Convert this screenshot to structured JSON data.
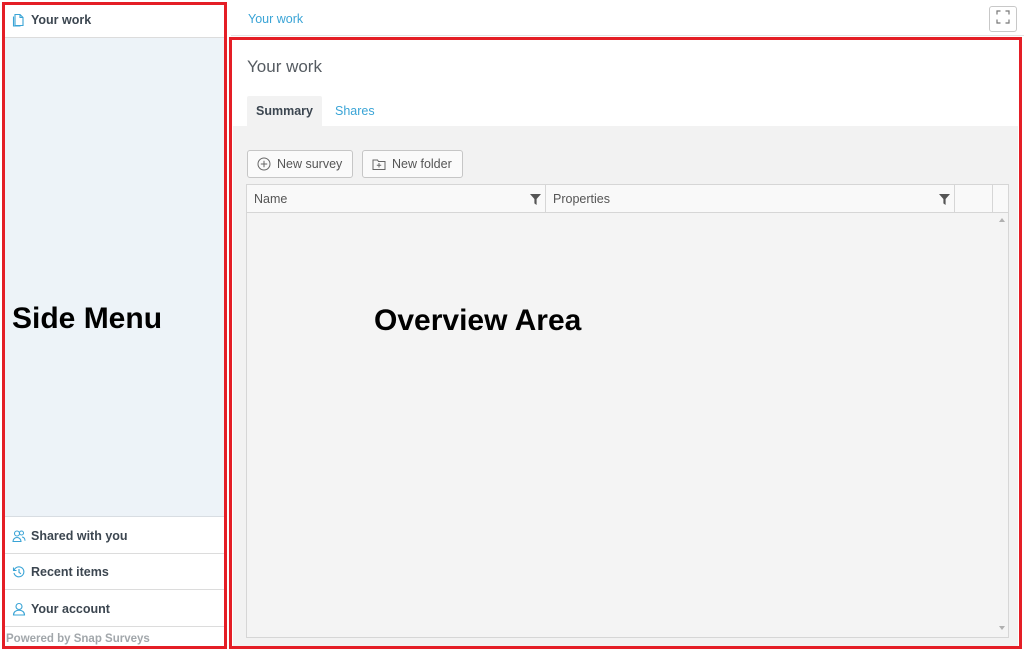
{
  "sidebar": {
    "top_item": {
      "label": "Your work",
      "icon": "documents-icon"
    },
    "bottom_items": [
      {
        "label": "Shared with you",
        "icon": "users-icon"
      },
      {
        "label": "Recent items",
        "icon": "history-icon"
      },
      {
        "label": "Your account",
        "icon": "user-icon"
      }
    ],
    "footer": "Powered by Snap Surveys"
  },
  "header": {
    "breadcrumb": "Your work",
    "fullscreen_icon": "fullscreen-icon"
  },
  "main": {
    "title": "Your work",
    "tabs": [
      {
        "label": "Summary",
        "active": true
      },
      {
        "label": "Shares",
        "active": false
      }
    ],
    "toolbar": {
      "new_survey_label": "New survey",
      "new_folder_label": "New folder"
    },
    "table": {
      "columns": [
        "Name",
        "Properties"
      ],
      "rows": []
    }
  },
  "annotations": {
    "side_label": "Side Menu",
    "main_label": "Overview Area",
    "color": "#e41e26"
  },
  "colors": {
    "accent": "#3aa4d6",
    "sidebar_bg": "#edf3f8"
  }
}
